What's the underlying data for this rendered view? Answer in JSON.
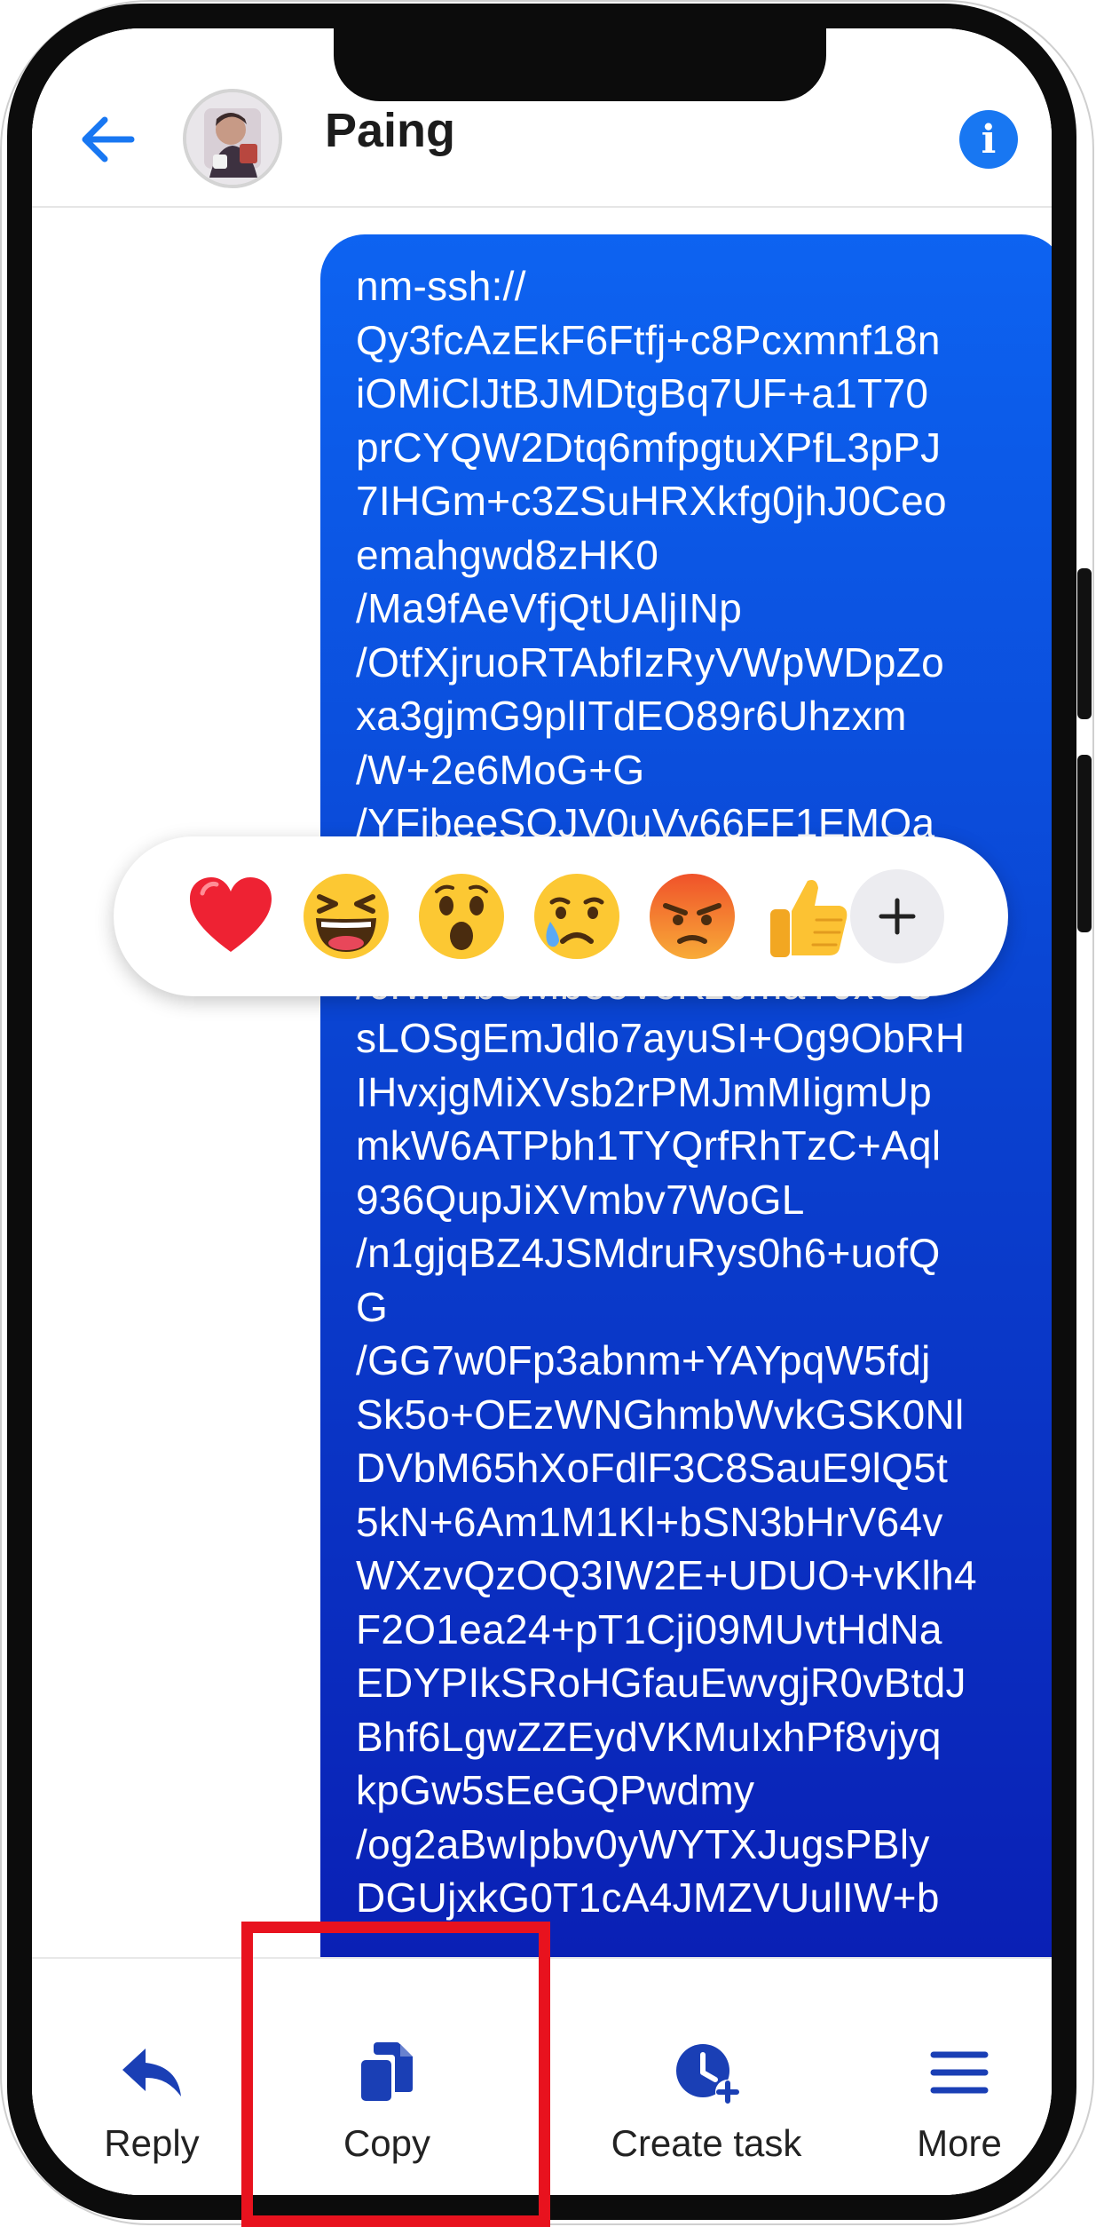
{
  "header": {
    "contact_name": "Paing",
    "back_icon": "back-arrow-icon",
    "info_icon": "info-icon",
    "info_glyph": "i",
    "avatar_icon": "profile-photo"
  },
  "message": {
    "text": "nm-ssh://\nQy3fcAzEkF6Ftfj+c8Pcxmnf18n\niOMiClJtBJMDtgBq7UF+a1T70\nprCYQW2Dtq6mfpgtuXPfL3pPJ\n7IHGm+c3ZSuHRXkfg0jhJ0Ceo\nemahgwd8zHK0\n/Ma9fAeVfjQtUAljINp\n/OtfXjruoRTAbfIzRyVWpWDpZo\nxa3gjmG9plITdEO89r6Uhzxm\n/W+2e6MoG+G\n/YFjbeeSOJV0uVy66FF1EMOa\nmWcJPWcWiJpq7gbsxlTHo5iK\nk6BUJ5qq6Gz9IDE1jWlo\n/6rwWbCMbeeVeKz6maYJxOS\nsLOSgEmJdlo7ayuSI+Og9ObRH\nIHvxjgMiXVsb2rPMJmMIigmUp\nmkW6ATPbh1TYQrfRhTzC+Aql\n936QupJiXVmbv7WoGL\n/n1gjqBZ4JSMdruRys0h6+uofQ\nG\n/GG7w0Fp3abnm+YAYpqW5fdj\nSk5o+OEzWNGhmbWvkGSK0Nl\nDVbM65hXoFdlF3C8SauE9lQ5t\n5kN+6Am1M1Kl+bSN3bHrV64v\nWXzvQzOQ3IW2E+UDUO+vKlh4\nF2O1ea24+pT1Cji09MUvtHdNa\nEDYPIkSRoHGfauEwvgjR0vBtdJ\nBhf6LgwZZEydVKMuIxhPf8vjyq\nkpGw5sEeGQPwdmy\n/og2aBwIpbv0yWYTXJugsPBly\nDGUjxkG0T1cA4JMZVUulIW+b"
  },
  "reactions": [
    {
      "name": "heart",
      "icon": "heart-icon"
    },
    {
      "name": "laugh",
      "icon": "laughing-face-icon"
    },
    {
      "name": "wow",
      "icon": "surprised-face-icon"
    },
    {
      "name": "sad",
      "icon": "crying-face-icon"
    },
    {
      "name": "angry",
      "icon": "angry-face-icon"
    },
    {
      "name": "like",
      "icon": "thumbs-up-icon"
    }
  ],
  "reaction_more_icon": "plus-icon",
  "actions": [
    {
      "label": "Reply",
      "icon": "reply-icon"
    },
    {
      "label": "Copy",
      "icon": "copy-icon"
    },
    {
      "label": "Create task",
      "icon": "create-task-icon"
    },
    {
      "label": "More",
      "icon": "menu-icon"
    }
  ],
  "annotation": {
    "highlight_color": "#e8121e",
    "target": "Copy"
  },
  "colors": {
    "bubble_top": "#0d63f1",
    "bubble_bottom": "#0a1fb4",
    "accent": "#1877f2",
    "action_icon": "#1a3fb5",
    "frame": "#0c0c0c"
  }
}
